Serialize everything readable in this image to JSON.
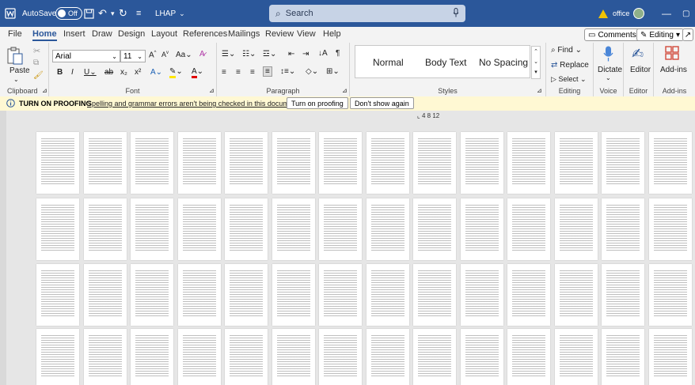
{
  "titlebar": {
    "autosave_label": "AutoSave",
    "autosave_state": "Off",
    "doc_name": "LHAP",
    "search_placeholder": "Search",
    "account": "office"
  },
  "menu": {
    "items": [
      "File",
      "Home",
      "Insert",
      "Draw",
      "Design",
      "Layout",
      "References",
      "Mailings",
      "Review",
      "View",
      "Help"
    ],
    "active": "Home",
    "comments_label": "Comments",
    "editing_label": "Editing"
  },
  "ribbon": {
    "clipboard": {
      "paste": "Paste",
      "label": "Clipboard"
    },
    "font": {
      "name": "Arial",
      "size": "11",
      "label": "Font"
    },
    "paragraph": {
      "label": "Paragraph"
    },
    "styles": {
      "items": [
        "Normal",
        "Body Text",
        "No Spacing"
      ],
      "label": "Styles"
    },
    "editing": {
      "find": "Find",
      "replace": "Replace",
      "select": "Select",
      "label": "Editing"
    },
    "voice": {
      "dictate": "Dictate",
      "label": "Voice"
    },
    "editor": {
      "button": "Editor",
      "label": "Editor"
    },
    "addins": {
      "button": "Add-ins",
      "label": "Add-ins"
    }
  },
  "proofing": {
    "title": "TURN ON PROOFING",
    "message": "Spelling and grammar errors aren't being checked in this document.",
    "turn_on": "Turn on proofing",
    "dont_show": "Don't show again"
  },
  "ruler": "4 8 12",
  "colors": {
    "accent": "#2b579a",
    "proofing_bg": "#fff8d3"
  }
}
